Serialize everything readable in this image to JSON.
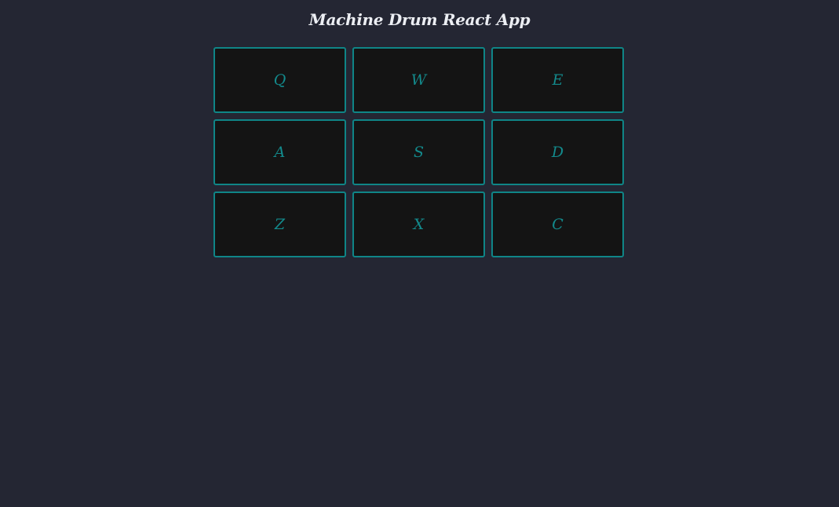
{
  "app": {
    "title": "Machine Drum React App"
  },
  "pads": [
    {
      "key": "Q"
    },
    {
      "key": "W"
    },
    {
      "key": "E"
    },
    {
      "key": "A"
    },
    {
      "key": "S"
    },
    {
      "key": "D"
    },
    {
      "key": "Z"
    },
    {
      "key": "X"
    },
    {
      "key": "C"
    }
  ],
  "colors": {
    "background": "#242633",
    "pad_background": "#141414",
    "pad_border": "#0f8587",
    "pad_text": "#138a8c",
    "title_text": "#eceef3"
  }
}
